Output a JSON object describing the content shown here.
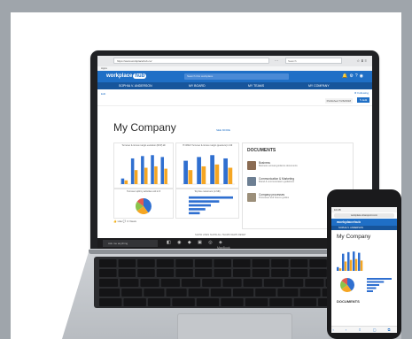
{
  "browser": {
    "url": "https://www.workplacehub.co/",
    "search_placeholder": "Search",
    "bookmarks": "Apps"
  },
  "app": {
    "logo_main": "workplace",
    "logo_hub": "hub",
    "search_placeholder": "Search this workplace",
    "nav": [
      "SOPHIA V. ANDERSON",
      "MY BOARD",
      "MY TEAMS",
      "MY COMPANY"
    ],
    "subbar": {
      "edit_label": "Edit",
      "following": "★ Following",
      "published": "Published 7/26/2018",
      "edit_button": "✎ Edit"
    },
    "page_title": "My Company",
    "more_link": "SEE MORE",
    "charts": [
      {
        "title": "Turnover & Gross margin evolution (RFP) k€"
      },
      {
        "title": "IT OPEX Turnover & Gross margin (quarters) in K€"
      },
      {
        "title": "Turnover split by activities unit in €"
      },
      {
        "title": "Top five customers (in M€)"
      }
    ],
    "documents": {
      "heading": "DOCUMENTS",
      "items": [
        {
          "name": "Business",
          "desc": "Business annual guidance documents"
        },
        {
          "name": "Communication & Marketing",
          "desc": "Brand & communication guidelines"
        },
        {
          "name": "Company processes",
          "desc": "Processes and how-to guides"
        }
      ]
    },
    "like_row": "👍 Like    💬 0 Views",
    "bottom_tabs": "SHOW LIKES    SHOW ALL TEAMS NEWS    RESET",
    "taskbar_search": "Ask me anything",
    "taskbar_time": "10:24 AM"
  },
  "laptop": {
    "brand": "MacBook"
  },
  "phone": {
    "status_time": "10:28",
    "url": "workplace.sharepoint.com",
    "logo": "workplacehub",
    "nav": "SOPHIA V. ANDERSON",
    "title": "My Company",
    "docs_heading": "DOCUMENTS",
    "toolbar": "‹ › ⇧ ▢ ⧉"
  },
  "chart_data": [
    {
      "type": "bar",
      "title": "Turnover & Gross margin evolution (RFP) k€",
      "series": [
        {
          "values": [
            12,
            55,
            60,
            62,
            58
          ]
        },
        {
          "values": [
            8,
            30,
            35,
            38,
            33
          ]
        }
      ]
    },
    {
      "type": "bar",
      "title": "IT OPEX Turnover & Gross margin (quarters) in K€",
      "series": [
        {
          "values": [
            50,
            58,
            62,
            55
          ]
        },
        {
          "values": [
            30,
            38,
            42,
            35
          ]
        }
      ]
    },
    {
      "type": "pie",
      "title": "Turnover split by activities unit in €",
      "values": [
        40,
        25,
        20,
        15
      ]
    },
    {
      "type": "bar",
      "title": "Top five customers (in M€)",
      "values": [
        80,
        55,
        40,
        30,
        20
      ]
    }
  ],
  "colors": {
    "brand": "#1f6fc6",
    "nav": "#17559b",
    "bar_primary": "#2f6fd0",
    "bar_secondary": "#f5a623"
  }
}
